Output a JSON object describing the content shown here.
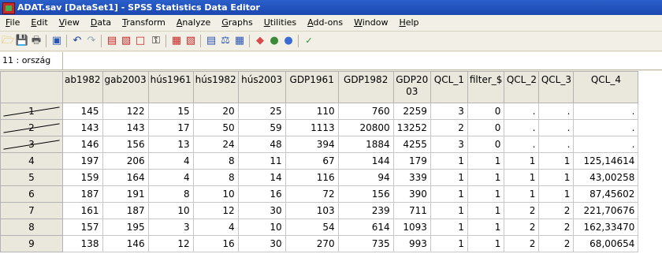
{
  "window": {
    "title": "ADAT.sav [DataSet1] - SPSS Statistics Data Editor"
  },
  "menu": [
    "File",
    "Edit",
    "View",
    "Data",
    "Transform",
    "Analyze",
    "Graphs",
    "Utilities",
    "Add-ons",
    "Window",
    "Help"
  ],
  "toolbar": {
    "icons": [
      "open-icon",
      "save-icon",
      "print-icon",
      "dialog-recall-icon",
      "undo-icon",
      "redo-icon",
      "goto-case-icon",
      "goto-variable-icon",
      "variables-icon",
      "find-icon",
      "insert-cases-icon",
      "insert-variable-icon",
      "split-file-icon",
      "weight-cases-icon",
      "select-cases-icon",
      "value-labels-icon",
      "use-sets-icon",
      "show-all-variables-icon",
      "spell-check-icon"
    ]
  },
  "cell_ref": {
    "label": "11 : ország",
    "value": ""
  },
  "grid": {
    "columns": [
      "ab1982",
      "gab2003",
      "hús1961",
      "hús1982",
      "hús2003",
      "GDP1961",
      "GDP1982",
      "GDP2003",
      "QCL_1",
      "filter_$",
      "QCL_2",
      "QCL_3",
      "QCL_4"
    ],
    "rows": [
      {
        "num": "1",
        "filtered": true,
        "cells": [
          "145",
          "122",
          "15",
          "20",
          "25",
          "110",
          "760",
          "2259",
          "3",
          "0",
          ".",
          ".",
          "."
        ]
      },
      {
        "num": "2",
        "filtered": true,
        "cells": [
          "143",
          "143",
          "17",
          "50",
          "59",
          "1113",
          "20800",
          "13252",
          "2",
          "0",
          ".",
          ".",
          "."
        ]
      },
      {
        "num": "3",
        "filtered": true,
        "cells": [
          "146",
          "156",
          "13",
          "24",
          "48",
          "394",
          "1884",
          "4255",
          "3",
          "0",
          ".",
          ".",
          "."
        ]
      },
      {
        "num": "4",
        "filtered": false,
        "cells": [
          "197",
          "206",
          "4",
          "8",
          "11",
          "67",
          "144",
          "179",
          "1",
          "1",
          "1",
          "1",
          "125,14614"
        ]
      },
      {
        "num": "5",
        "filtered": false,
        "cells": [
          "159",
          "164",
          "4",
          "8",
          "14",
          "116",
          "94",
          "339",
          "1",
          "1",
          "1",
          "1",
          "43,00258"
        ]
      },
      {
        "num": "6",
        "filtered": false,
        "cells": [
          "187",
          "191",
          "8",
          "10",
          "16",
          "72",
          "156",
          "390",
          "1",
          "1",
          "1",
          "1",
          "87,45602"
        ]
      },
      {
        "num": "7",
        "filtered": false,
        "cells": [
          "161",
          "187",
          "10",
          "12",
          "30",
          "103",
          "239",
          "711",
          "1",
          "1",
          "2",
          "2",
          "221,70676"
        ]
      },
      {
        "num": "8",
        "filtered": false,
        "cells": [
          "157",
          "195",
          "3",
          "4",
          "10",
          "54",
          "614",
          "1093",
          "1",
          "1",
          "2",
          "2",
          "162,33470"
        ]
      },
      {
        "num": "9",
        "filtered": false,
        "cells": [
          "138",
          "146",
          "12",
          "16",
          "30",
          "270",
          "735",
          "993",
          "1",
          "1",
          "2",
          "2",
          "68,00654"
        ]
      }
    ]
  },
  "colors": {
    "title_bar": "#1c47b0",
    "header_bg": "#eae7dc",
    "chrome_bg": "#f2f0e6"
  }
}
